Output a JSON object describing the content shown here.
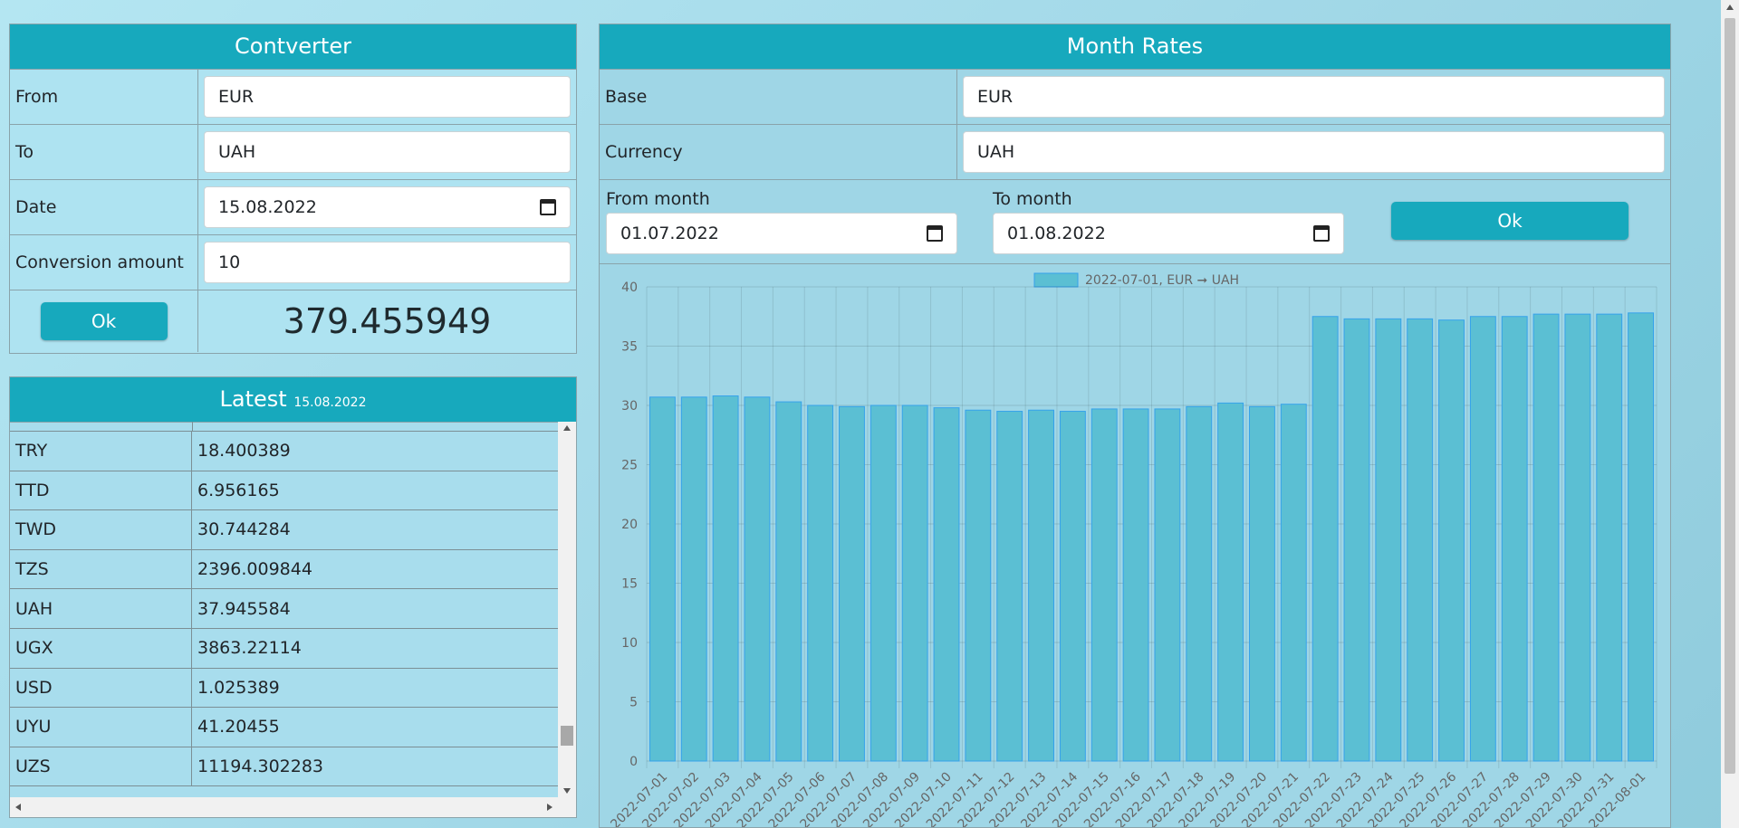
{
  "converter": {
    "title": "Contverter",
    "from_label": "From",
    "from_value": "EUR",
    "to_label": "To",
    "to_value": "UAH",
    "date_label": "Date",
    "date_value": "15.08.2022",
    "amount_label": "Conversion amount",
    "amount_value": "10",
    "ok_label": "Ok",
    "result": "379.455949"
  },
  "latest": {
    "title": "Latest",
    "date": "15.08.2022",
    "rows": [
      {
        "code": "TRY",
        "value": "18.400389"
      },
      {
        "code": "TTD",
        "value": "6.956165"
      },
      {
        "code": "TWD",
        "value": "30.744284"
      },
      {
        "code": "TZS",
        "value": "2396.009844"
      },
      {
        "code": "UAH",
        "value": "37.945584"
      },
      {
        "code": "UGX",
        "value": "3863.22114"
      },
      {
        "code": "USD",
        "value": "1.025389"
      },
      {
        "code": "UYU",
        "value": "41.20455"
      },
      {
        "code": "UZS",
        "value": "11194.302283"
      }
    ]
  },
  "month_rates": {
    "title": "Month Rates",
    "base_label": "Base",
    "base_value": "EUR",
    "currency_label": "Currency",
    "currency_value": "UAH",
    "from_month_label": "From month",
    "from_month_value": "01.07.2022",
    "to_month_label": "To month",
    "to_month_value": "01.08.2022",
    "ok_label": "Ok"
  },
  "colors": {
    "accent": "#17a9bd",
    "bar_fill": "#5bbfd3",
    "bar_stroke": "#36a2eb"
  },
  "chart_data": {
    "type": "bar",
    "legend": "2022-07-01, EUR ➞ UAH",
    "ylim": [
      0,
      40
    ],
    "yticks": [
      0,
      5,
      10,
      15,
      20,
      25,
      30,
      35,
      40
    ],
    "categories": [
      "2022-07-01",
      "2022-07-02",
      "2022-07-03",
      "2022-07-04",
      "2022-07-05",
      "2022-07-06",
      "2022-07-07",
      "2022-07-08",
      "2022-07-09",
      "2022-07-10",
      "2022-07-11",
      "2022-07-12",
      "2022-07-13",
      "2022-07-14",
      "2022-07-15",
      "2022-07-16",
      "2022-07-17",
      "2022-07-18",
      "2022-07-19",
      "2022-07-20",
      "2022-07-21",
      "2022-07-22",
      "2022-07-23",
      "2022-07-24",
      "2022-07-25",
      "2022-07-26",
      "2022-07-27",
      "2022-07-28",
      "2022-07-29",
      "2022-07-30",
      "2022-07-31",
      "2022-08-01"
    ],
    "values": [
      30.7,
      30.7,
      30.8,
      30.7,
      30.3,
      30.0,
      29.9,
      30.0,
      30.0,
      29.8,
      29.6,
      29.5,
      29.6,
      29.5,
      29.7,
      29.7,
      29.7,
      29.9,
      30.2,
      29.9,
      30.1,
      37.5,
      37.3,
      37.3,
      37.3,
      37.2,
      37.5,
      37.5,
      37.7,
      37.7,
      37.7,
      37.8
    ]
  }
}
